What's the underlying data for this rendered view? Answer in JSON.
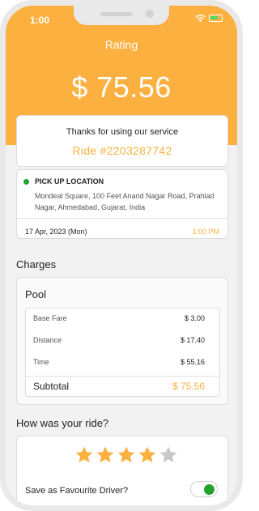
{
  "status_bar": {
    "time": "1:00"
  },
  "header": {
    "title": "Rating",
    "amount": "$ 75.56"
  },
  "thanks_card": {
    "message": "Thanks for using our service",
    "ride_id": "Ride #2203287742"
  },
  "pickup": {
    "title": "PICK UP LOCATION",
    "address": "Mondeal Square, 100 Feet Anand Nagar Road, Prahlad Nagar, Ahmedabad, Gujarat, India",
    "date": "17 Apr, 2023 (Mon)",
    "time": "1:00 PM"
  },
  "charges": {
    "title": "Charges",
    "pool_title": "Pool",
    "rows": [
      {
        "label": "Base Fare",
        "value": "$ 3.00"
      },
      {
        "label": "Distance",
        "value": "$ 17.40"
      },
      {
        "label": "Time",
        "value": "$ 55.16"
      }
    ],
    "subtotal_label": "Subtotal",
    "subtotal_value": "$ 75.56"
  },
  "rating": {
    "title": "How was your ride?",
    "stars_selected": 4,
    "stars_total": 5,
    "favourite_label": "Save as Favourite Driver?",
    "favourite_on": true
  },
  "colors": {
    "accent": "#fbb040",
    "success": "#22a12f",
    "star_filled": "#fbb040",
    "star_empty": "#c8c8c8"
  },
  "icons": [
    "wifi-icon",
    "battery-icon",
    "location-dot-icon",
    "star-icon"
  ]
}
